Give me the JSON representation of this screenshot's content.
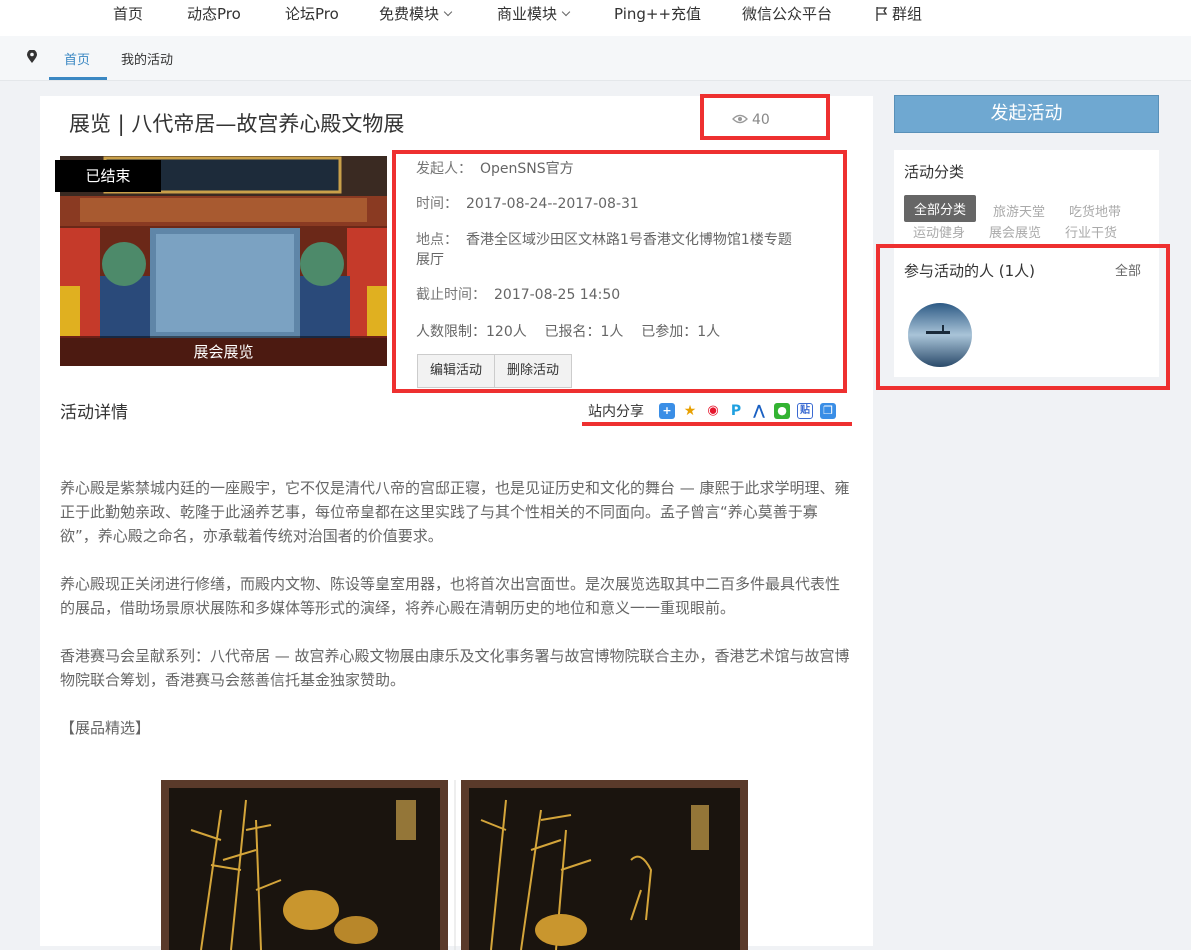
{
  "topnav": {
    "items": [
      "首页",
      "动态Pro",
      "论坛Pro",
      "免费模块",
      "商业模块",
      "Ping++充值",
      "微信公众平台",
      "群组"
    ]
  },
  "subnav": {
    "tabs": [
      "首页",
      "我的活动"
    ]
  },
  "event": {
    "title": "展览 | 八代帝居—故宫养心殿文物展",
    "views": "40",
    "status_badge": "已结束",
    "cover_caption": "展会展览",
    "organizer_label": "发起人：",
    "organizer": "OpenSNS官方",
    "time_label": "时间：",
    "time": "2017-08-24--2017-08-31",
    "location_label": "地点：",
    "location_line1": "香港全区域沙田区文林路1号香港文化博物馆1楼专题",
    "location_line2": "展厅",
    "deadline_label": "截止时间：",
    "deadline": "2017-08-25 14:50",
    "limit_text": "人数限制：120人    已报名：1人    已参加：1人",
    "edit_button": "编辑活动",
    "delete_button": "删除活动"
  },
  "details": {
    "heading": "活动详情",
    "share_label": "站内分享",
    "share_icons": [
      "plus-share-icon",
      "qzone-icon",
      "weibo-icon",
      "pengyou-icon",
      "renren-icon",
      "wechat-icon",
      "tieba-icon",
      "copy-icon"
    ],
    "paragraph1": "养心殿是紫禁城内廷的一座殿宇，它不仅是清代八帝的宫邸正寝，也是见证历史和文化的舞台 — 康熙于此求学明理、雍正于此勤勉亲政、乾隆于此涵养艺事，每位帝皇都在这里实践了与其个性相关的不同面向。孟子曾言“养心莫善于寡欲”，养心殿之命名，亦承载着传统对治国者的价值要求。",
    "paragraph2": "养心殿现正关闭进行修缮，而殿内文物、陈设等皇室用器，也将首次出宫面世。是次展览选取其中二百多件最具代表性的展品，借助场景原状展陈和多媒体等形式的演绎，将养心殿在清朝历史的地位和意义一一重现眼前。",
    "paragraph3": "香港赛马会呈献系列：八代帝居 — 故宫养心殿文物展由康乐及文化事务署与故宫博物院联合主办，香港艺术馆与故宫博物院联合筹划，香港赛马会慈善信托基金独家赞助。",
    "paragraph4": "【展品精选】"
  },
  "sidebar": {
    "create_button": "发起活动",
    "category_heading": "活动分类",
    "categories": [
      "全部分类",
      "旅游天堂",
      "吃货地带",
      "运动健身",
      "展会展览",
      "行业干货"
    ],
    "participants_heading": "参与活动的人 (1人)",
    "participants_all": "全部"
  },
  "colors": {
    "accent": "#3b88c3",
    "highlight_red": "#ee3030",
    "create_button": "#6fa8d1"
  }
}
